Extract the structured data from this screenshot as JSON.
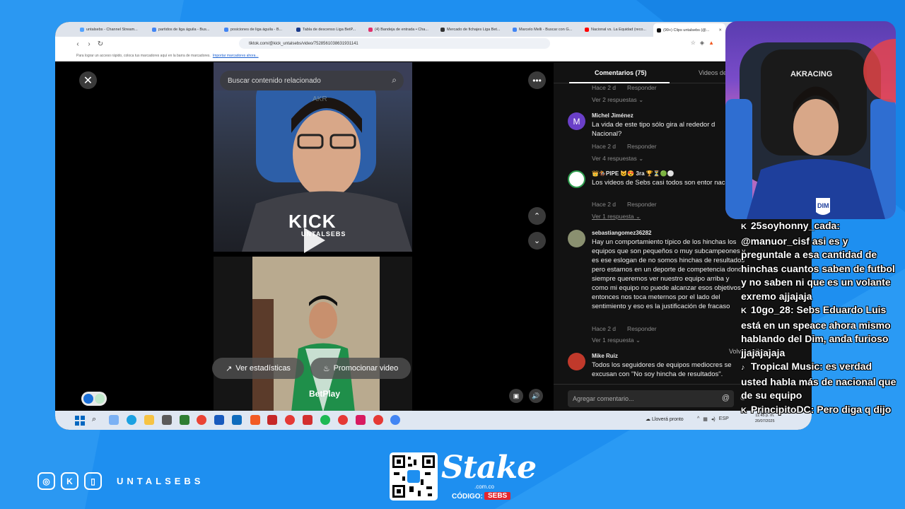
{
  "browser": {
    "tabs": [
      {
        "label": "untalsebs - Channel Stream...",
        "color": "#53a3ff"
      },
      {
        "label": "partidos de liga águila - Bus...",
        "color": "#4285f4"
      },
      {
        "label": "posiciones de liga águila - B...",
        "color": "#4285f4"
      },
      {
        "label": "Tabla de descenso Liga BetP...",
        "color": "#1a3a8a"
      },
      {
        "label": "(4) Bandeja de entrada • Cha...",
        "color": "#e1306c"
      },
      {
        "label": "Mercado de fichajes Liga Bet...",
        "color": "#333333"
      },
      {
        "label": "Marcelo Melli - Buscar con G...",
        "color": "#4285f4"
      },
      {
        "label": "Nacional vs. La Equidad (reco...",
        "color": "#ff0000"
      },
      {
        "label": "(99+) Clips untalsebs (@...",
        "color": "#111111"
      }
    ],
    "url": "tiktok.com/@kick_untalsebs/video/7528561038631931141",
    "bookmarks_text": "Para lograr un acceso rápido, coloca tus marcadores aquí en la barra de marcadores.",
    "bookmarks_link": "Importar marcadores ahora..."
  },
  "video": {
    "search_placeholder": "Buscar contenido relacionado",
    "kick_brand": "KICK",
    "kick_sub": "UNTALSEBS",
    "stats_button": "Ver estadísticas",
    "promo_button": "Promocionar video"
  },
  "comments": {
    "tab_comments": "Comentarios (75)",
    "tab_videos": "Videos de",
    "top_meta": {
      "time": "Hace 2 d",
      "reply": "Responder"
    },
    "top_replies": "Ver 2 respuestas",
    "items": [
      {
        "user": "Michel Jiménez",
        "text": "La vida de este tipo sólo gira al rededor d Nacional?",
        "time": "Hace 2 d",
        "reply": "Responder",
        "replies": "Ver 4 respuestas",
        "avatar_letter": "M",
        "avatar_color": "#6a3fc8"
      },
      {
        "user": "👑🏇PIPE 😺😍 3ra 🏆⏳🟢⚪",
        "text": "Los videos de Sebs casi todos son entor nacional",
        "time": "Hace 2 d",
        "reply": "Responder",
        "replies": "Ver 1 respuesta",
        "avatar_letter": "",
        "avatar_color": "#ffffff"
      },
      {
        "user": "sebastiangomez36282",
        "text": "Hay un comportamiento típico de los hinchas los equipos que son pequeños o muy subcampeones y es ese eslogan de no somos hinchas de resultados pero estamos en un deporte de competencia donde siempre queremos ver nuestro equipo arriba y como mi equipo no puede alcanzar esos objetivos entonces nos toca meternos por el lado del sentimiento y eso es la justificación de fracaso",
        "time": "Hace 2 d",
        "reply": "Responder",
        "replies": "Ver 1 respuesta",
        "avatar_letter": "",
        "avatar_color": "#8a9070"
      },
      {
        "user": "Mike Ruiz",
        "text": "Todos los seguidores de equipos mediocres se excusan con \"No soy hincha de resultados\".",
        "time": "",
        "reply": "",
        "replies": "",
        "avatar_letter": "",
        "avatar_color": "#c0392b"
      }
    ],
    "back_to_top": "Volver arriba",
    "input_placeholder": "Agregar comentario..."
  },
  "taskbar": {
    "weather": "Lloverá pronto",
    "lang": "ESP",
    "time": "11:45 p. m.",
    "date": "20/07/2025"
  },
  "chat": [
    {
      "user": "25soyhonny_cada",
      "message": "@manuor_cisf asi es y preguntale a esa cantidad de hinchas cuantos saben de futbol y no saben ni que es un volante exremo ajjajaja",
      "badge": "kick"
    },
    {
      "user": "10go_28",
      "message": "Sebs Eduardo Luis está en un speace ahora mismo hablando del Dim, anda furioso jjajajajaja",
      "badge": "kick"
    },
    {
      "user": "Tropical Music",
      "message": "es verdad usted habla más de nacional que de su equipo",
      "badge": "tiktok"
    },
    {
      "user": "PrincipitoDC",
      "message": "Pero diga q dijo",
      "badge": "kick"
    }
  ],
  "footer": {
    "handle": "UNTALSEBS",
    "sponsor": "Stake",
    "sponsor_domain": ".com.co",
    "code_label": "CÓDIGO:",
    "code_value": "SEBS"
  },
  "colors": {
    "background": "#1e8ff0",
    "tiktok_panel": "#121212",
    "code_badge": "#e3262e"
  }
}
